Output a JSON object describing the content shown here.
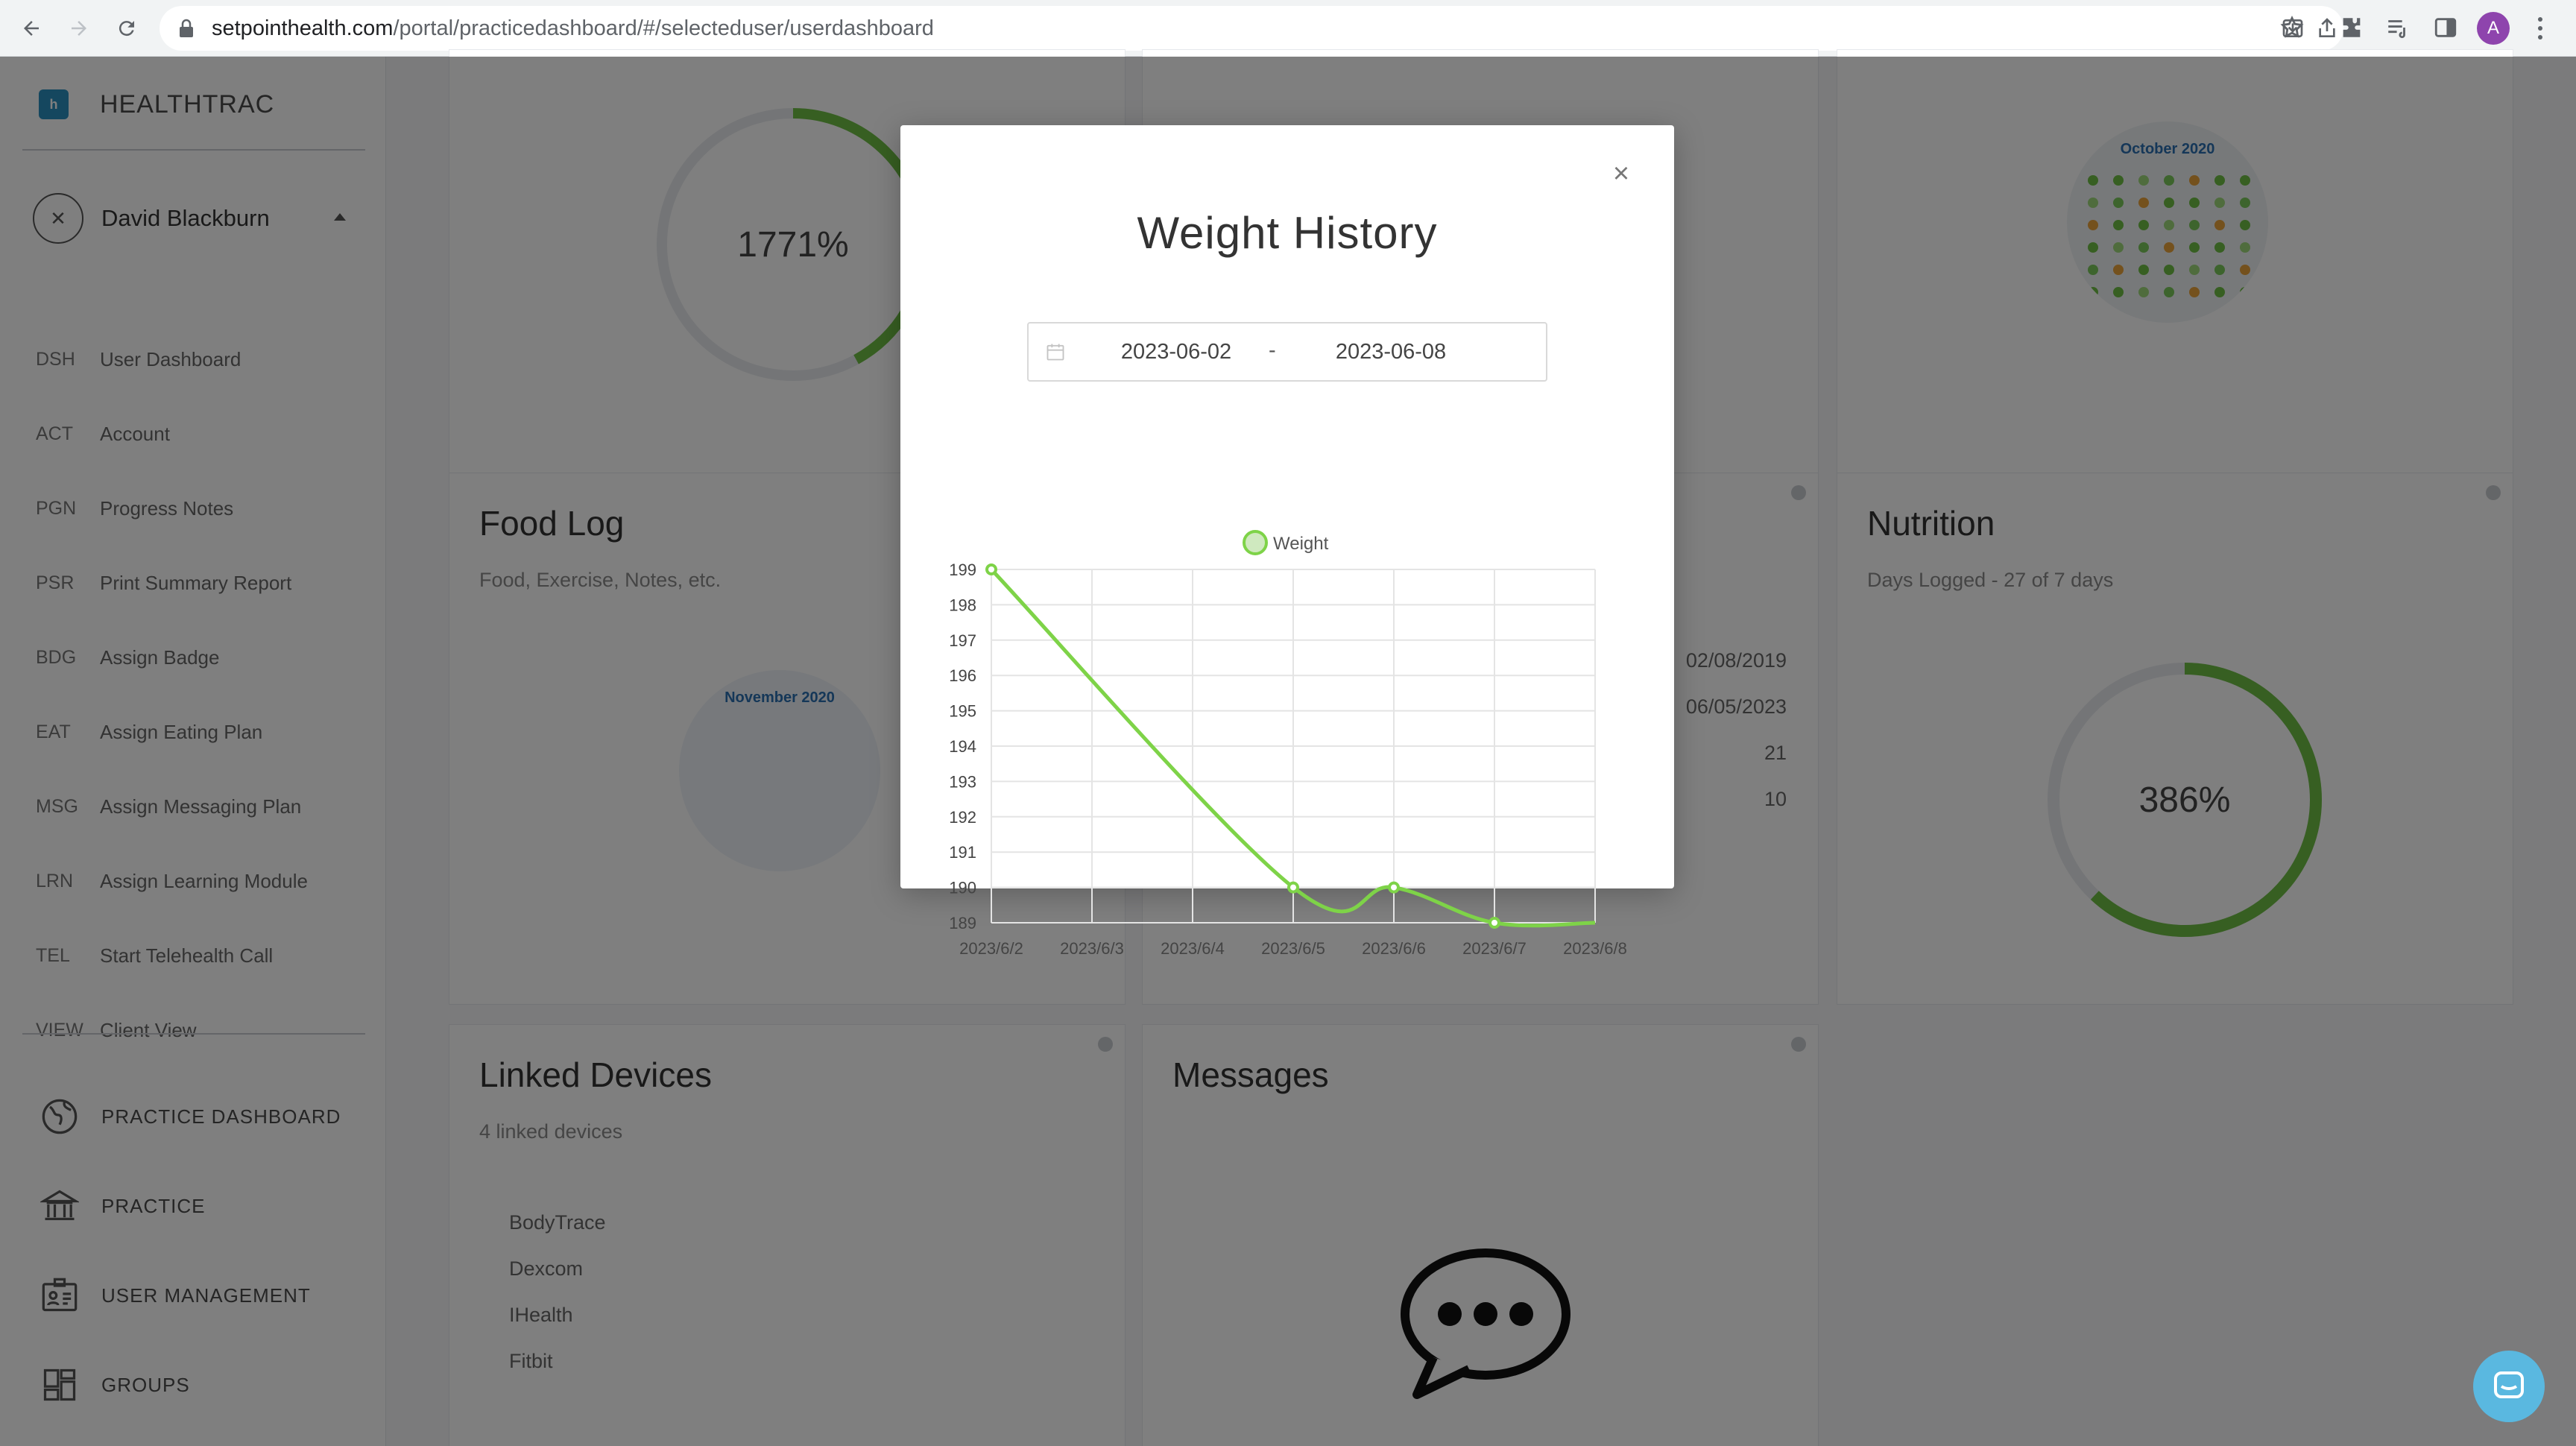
{
  "browser": {
    "url_host": "setpointhealth.com",
    "url_path": "/portal/practicedashboard/#/selecteduser/userdashboard",
    "profile_initial": "A"
  },
  "sidebar": {
    "brand": "HEALTHTRAC",
    "user_name": "David Blackburn",
    "user_avatar_glyph": "✕",
    "items": [
      {
        "code": "DSH",
        "label": "User Dashboard"
      },
      {
        "code": "ACT",
        "label": "Account"
      },
      {
        "code": "PGN",
        "label": "Progress Notes"
      },
      {
        "code": "PSR",
        "label": "Print Summary Report"
      },
      {
        "code": "BDG",
        "label": "Assign Badge"
      },
      {
        "code": "EAT",
        "label": "Assign Eating Plan"
      },
      {
        "code": "MSG",
        "label": "Assign Messaging Plan"
      },
      {
        "code": "LRN",
        "label": "Assign Learning Module"
      },
      {
        "code": "TEL",
        "label": "Start Telehealth Call"
      },
      {
        "code": "VIEW",
        "label": "Client View"
      }
    ],
    "bottom_items": [
      {
        "label": "PRACTICE DASHBOARD",
        "icon": "globe-icon"
      },
      {
        "label": "PRACTICE",
        "icon": "bank-icon"
      },
      {
        "label": "USER MANAGEMENT",
        "icon": "id-card-icon"
      },
      {
        "label": "GROUPS",
        "icon": "grid-icon"
      }
    ]
  },
  "cards": {
    "top_left_ring": {
      "value": "1771%",
      "progress": 0.42
    },
    "food_log": {
      "title": "Food Log",
      "subtitle": "Food, Exercise, Notes, etc.",
      "calendar_month": "November 2020"
    },
    "calendar_top_right": {
      "month": "October 2020"
    },
    "middle_stats": [
      "02/08/2019",
      "06/05/2023",
      "21",
      "10"
    ],
    "nutrition": {
      "title": "Nutrition",
      "subtitle": "Days Logged - 27 of 7 days",
      "value": "386%",
      "progress": 0.62
    },
    "linked_devices": {
      "title": "Linked Devices",
      "subtitle": "4 linked devices",
      "devices": [
        "BodyTrace",
        "Dexcom",
        "IHealth",
        "Fitbit"
      ]
    },
    "messages": {
      "title": "Messages"
    }
  },
  "modal": {
    "title": "Weight History",
    "close_glyph": "×",
    "date_start": "2023-06-02",
    "date_separator": "-",
    "date_end": "2023-06-08"
  },
  "colors": {
    "line": "#7ed348",
    "accent_green": "#6fbf45"
  },
  "chart_data": {
    "type": "line",
    "title": "",
    "xlabel": "",
    "ylabel": "",
    "legend_position": "top",
    "grid": true,
    "x": [
      "2023/6/2",
      "2023/6/3",
      "2023/6/4",
      "2023/6/5",
      "2023/6/6",
      "2023/6/7",
      "2023/6/8"
    ],
    "yticks": [
      199,
      198,
      197,
      196,
      195,
      194,
      193,
      192,
      191,
      190,
      189
    ],
    "ylim": [
      189,
      199
    ],
    "series": [
      {
        "name": "Weight",
        "values": [
          199,
          null,
          null,
          190,
          190,
          189,
          189
        ],
        "color": "#7ed348"
      }
    ]
  }
}
